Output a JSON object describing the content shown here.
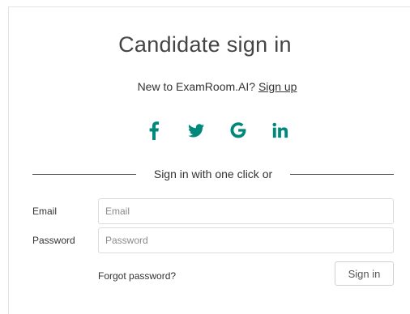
{
  "title": "Candidate sign in",
  "signup_prompt": {
    "text": "New to ExamRoom.AI?",
    "link_label": "Sign up"
  },
  "social": {
    "accent_color": "#00897B",
    "buttons": [
      {
        "icon": "facebook-icon"
      },
      {
        "icon": "twitter-icon"
      },
      {
        "icon": "google-icon"
      },
      {
        "icon": "linkedin-icon"
      }
    ]
  },
  "divider_text": "Sign in with one click or",
  "form": {
    "email": {
      "label": "Email",
      "placeholder": "Email",
      "value": ""
    },
    "password": {
      "label": "Password",
      "placeholder": "Password",
      "value": ""
    },
    "forgot_label": "Forgot password?",
    "submit_label": "Sign in"
  }
}
